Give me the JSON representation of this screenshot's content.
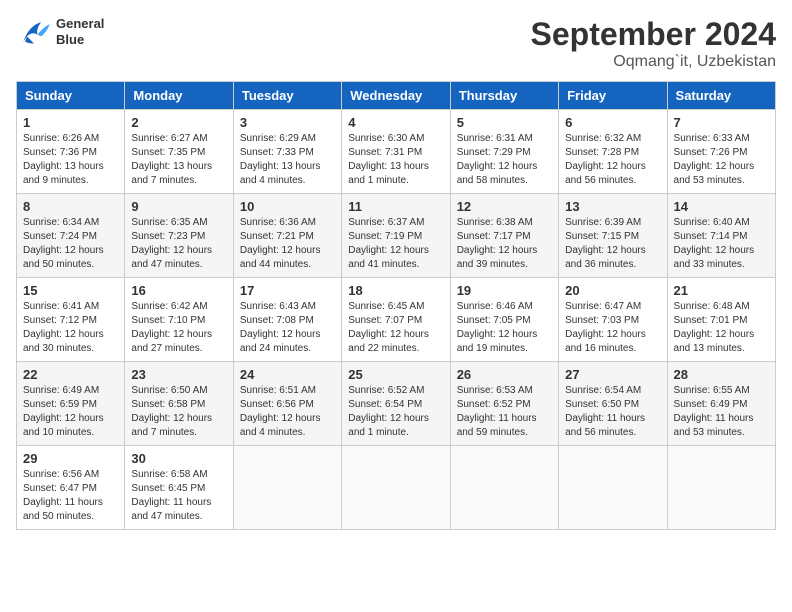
{
  "header": {
    "logo_line1": "General",
    "logo_line2": "Blue",
    "month": "September 2024",
    "location": "Oqmang`it, Uzbekistan"
  },
  "weekdays": [
    "Sunday",
    "Monday",
    "Tuesday",
    "Wednesday",
    "Thursday",
    "Friday",
    "Saturday"
  ],
  "weeks": [
    [
      {
        "day": "1",
        "info": "Sunrise: 6:26 AM\nSunset: 7:36 PM\nDaylight: 13 hours\nand 9 minutes."
      },
      {
        "day": "2",
        "info": "Sunrise: 6:27 AM\nSunset: 7:35 PM\nDaylight: 13 hours\nand 7 minutes."
      },
      {
        "day": "3",
        "info": "Sunrise: 6:29 AM\nSunset: 7:33 PM\nDaylight: 13 hours\nand 4 minutes."
      },
      {
        "day": "4",
        "info": "Sunrise: 6:30 AM\nSunset: 7:31 PM\nDaylight: 13 hours\nand 1 minute."
      },
      {
        "day": "5",
        "info": "Sunrise: 6:31 AM\nSunset: 7:29 PM\nDaylight: 12 hours\nand 58 minutes."
      },
      {
        "day": "6",
        "info": "Sunrise: 6:32 AM\nSunset: 7:28 PM\nDaylight: 12 hours\nand 56 minutes."
      },
      {
        "day": "7",
        "info": "Sunrise: 6:33 AM\nSunset: 7:26 PM\nDaylight: 12 hours\nand 53 minutes."
      }
    ],
    [
      {
        "day": "8",
        "info": "Sunrise: 6:34 AM\nSunset: 7:24 PM\nDaylight: 12 hours\nand 50 minutes."
      },
      {
        "day": "9",
        "info": "Sunrise: 6:35 AM\nSunset: 7:23 PM\nDaylight: 12 hours\nand 47 minutes."
      },
      {
        "day": "10",
        "info": "Sunrise: 6:36 AM\nSunset: 7:21 PM\nDaylight: 12 hours\nand 44 minutes."
      },
      {
        "day": "11",
        "info": "Sunrise: 6:37 AM\nSunset: 7:19 PM\nDaylight: 12 hours\nand 41 minutes."
      },
      {
        "day": "12",
        "info": "Sunrise: 6:38 AM\nSunset: 7:17 PM\nDaylight: 12 hours\nand 39 minutes."
      },
      {
        "day": "13",
        "info": "Sunrise: 6:39 AM\nSunset: 7:15 PM\nDaylight: 12 hours\nand 36 minutes."
      },
      {
        "day": "14",
        "info": "Sunrise: 6:40 AM\nSunset: 7:14 PM\nDaylight: 12 hours\nand 33 minutes."
      }
    ],
    [
      {
        "day": "15",
        "info": "Sunrise: 6:41 AM\nSunset: 7:12 PM\nDaylight: 12 hours\nand 30 minutes."
      },
      {
        "day": "16",
        "info": "Sunrise: 6:42 AM\nSunset: 7:10 PM\nDaylight: 12 hours\nand 27 minutes."
      },
      {
        "day": "17",
        "info": "Sunrise: 6:43 AM\nSunset: 7:08 PM\nDaylight: 12 hours\nand 24 minutes."
      },
      {
        "day": "18",
        "info": "Sunrise: 6:45 AM\nSunset: 7:07 PM\nDaylight: 12 hours\nand 22 minutes."
      },
      {
        "day": "19",
        "info": "Sunrise: 6:46 AM\nSunset: 7:05 PM\nDaylight: 12 hours\nand 19 minutes."
      },
      {
        "day": "20",
        "info": "Sunrise: 6:47 AM\nSunset: 7:03 PM\nDaylight: 12 hours\nand 16 minutes."
      },
      {
        "day": "21",
        "info": "Sunrise: 6:48 AM\nSunset: 7:01 PM\nDaylight: 12 hours\nand 13 minutes."
      }
    ],
    [
      {
        "day": "22",
        "info": "Sunrise: 6:49 AM\nSunset: 6:59 PM\nDaylight: 12 hours\nand 10 minutes."
      },
      {
        "day": "23",
        "info": "Sunrise: 6:50 AM\nSunset: 6:58 PM\nDaylight: 12 hours\nand 7 minutes."
      },
      {
        "day": "24",
        "info": "Sunrise: 6:51 AM\nSunset: 6:56 PM\nDaylight: 12 hours\nand 4 minutes."
      },
      {
        "day": "25",
        "info": "Sunrise: 6:52 AM\nSunset: 6:54 PM\nDaylight: 12 hours\nand 1 minute."
      },
      {
        "day": "26",
        "info": "Sunrise: 6:53 AM\nSunset: 6:52 PM\nDaylight: 11 hours\nand 59 minutes."
      },
      {
        "day": "27",
        "info": "Sunrise: 6:54 AM\nSunset: 6:50 PM\nDaylight: 11 hours\nand 56 minutes."
      },
      {
        "day": "28",
        "info": "Sunrise: 6:55 AM\nSunset: 6:49 PM\nDaylight: 11 hours\nand 53 minutes."
      }
    ],
    [
      {
        "day": "29",
        "info": "Sunrise: 6:56 AM\nSunset: 6:47 PM\nDaylight: 11 hours\nand 50 minutes."
      },
      {
        "day": "30",
        "info": "Sunrise: 6:58 AM\nSunset: 6:45 PM\nDaylight: 11 hours\nand 47 minutes."
      },
      {
        "day": "",
        "info": ""
      },
      {
        "day": "",
        "info": ""
      },
      {
        "day": "",
        "info": ""
      },
      {
        "day": "",
        "info": ""
      },
      {
        "day": "",
        "info": ""
      }
    ]
  ]
}
